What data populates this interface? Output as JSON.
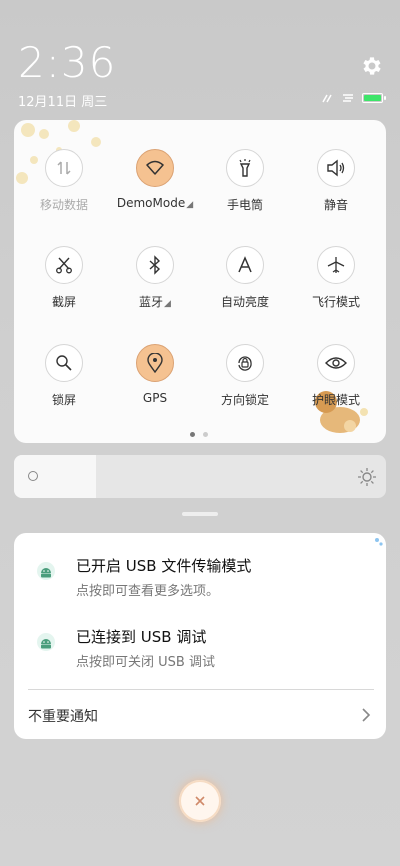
{
  "status": {
    "time": "2:36",
    "date": "12月11日 周三",
    "battery_level": 1.0,
    "battery_color": "#3ee56a"
  },
  "quick_settings": {
    "tiles": [
      {
        "label": "移动数据",
        "icon": "mobile-data-icon",
        "state": "disabled"
      },
      {
        "label": "DemoMode",
        "icon": "wifi-icon",
        "state": "active",
        "has_dropdown": true
      },
      {
        "label": "手电筒",
        "icon": "flashlight-icon",
        "state": "off"
      },
      {
        "label": "静音",
        "icon": "volume-icon",
        "state": "off"
      },
      {
        "label": "截屏",
        "icon": "screenshot-icon",
        "state": "off"
      },
      {
        "label": "蓝牙",
        "icon": "bluetooth-icon",
        "state": "off",
        "has_dropdown": true
      },
      {
        "label": "自动亮度",
        "icon": "auto-brightness-icon",
        "state": "off"
      },
      {
        "label": "飞行模式",
        "icon": "airplane-icon",
        "state": "off"
      },
      {
        "label": "锁屏",
        "icon": "lock-screen-icon",
        "state": "off"
      },
      {
        "label": "GPS",
        "icon": "location-icon",
        "state": "active"
      },
      {
        "label": "方向锁定",
        "icon": "rotation-lock-icon",
        "state": "off"
      },
      {
        "label": "护眼模式",
        "icon": "eye-icon",
        "state": "off"
      }
    ],
    "page_count": 2,
    "current_page": 1,
    "active_color": "#f5c291"
  },
  "brightness": {
    "level": 0.22
  },
  "notifications": [
    {
      "title": "已开启 USB 文件传输模式",
      "body": "点按即可查看更多选项。",
      "icon": "android-icon"
    },
    {
      "title": "已连接到 USB 调试",
      "body": "点按即可关闭 USB 调试",
      "icon": "android-icon"
    }
  ],
  "unimportant": {
    "label": "不重要通知"
  }
}
